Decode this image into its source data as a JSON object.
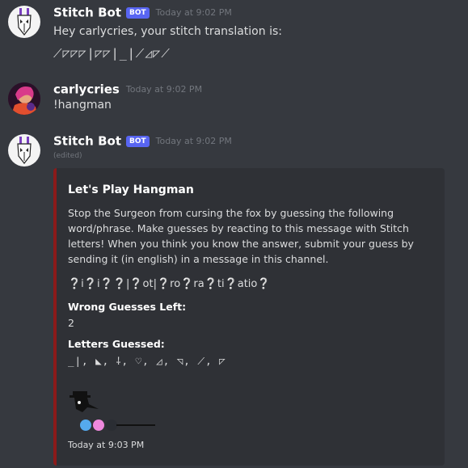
{
  "messages": [
    {
      "username": "Stitch Bot",
      "badge": "BOT",
      "timestamp": "Today at 9:02 PM",
      "text": "Hey carlycries, your stitch translation is:",
      "translation": "⟋◸◸◸|◸◸|_|⟋◿◸⟋"
    },
    {
      "username": "carlycries",
      "timestamp": "Today at 9:02 PM",
      "text": "!hangman"
    },
    {
      "username": "Stitch Bot",
      "badge": "BOT",
      "timestamp": "Today at 9:02 PM",
      "edited": "(edited)"
    }
  ],
  "embed": {
    "accent_color": "#8b1a1a",
    "title": "Let's Play Hangman",
    "description": "Stop the Surgeon from cursing the fox by guessing the following word/phrase. Make guesses by reacting to this message with Stitch letters! When you think you know the answer, submit your guess by sending it (in english) in a message in this channel.",
    "puzzle": "❔i❔i❔❔|❔ot|❔ro❔ra❔ti❔atio❔",
    "fields": [
      {
        "name": "Wrong Guesses Left:",
        "value": "2"
      },
      {
        "name": "Letters Guessed:",
        "value": "_|, ◣, ⸸, ♡, ◿, ◹, ⟋, ◸"
      }
    ],
    "footer": "Today at 9:03 PM",
    "image_icon": "plague-doctor-icon",
    "dot_colors": [
      "#55aaee",
      "#ee88dd",
      "#2a2d33"
    ]
  }
}
